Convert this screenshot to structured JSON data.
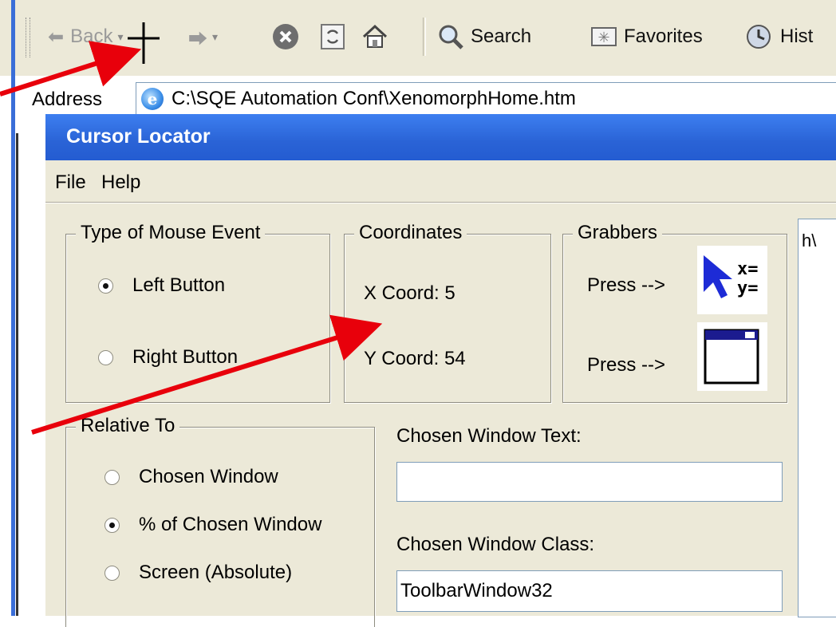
{
  "browser": {
    "toolbar": {
      "back_label": "Back",
      "search_label": "Search",
      "favorites_label": "Favorites",
      "history_label": "Hist"
    },
    "address": {
      "label": "Address",
      "value": "C:\\SQE Automation Conf\\XenomorphHome.htm"
    }
  },
  "dialog": {
    "title": "Cursor Locator",
    "menu": [
      "File",
      "Help"
    ],
    "mouse_event": {
      "legend": "Type of Mouse Event",
      "options": [
        {
          "label": "Left Button",
          "checked": true
        },
        {
          "label": "Right Button",
          "checked": false
        }
      ]
    },
    "coordinates": {
      "legend": "Coordinates",
      "x_label": "X Coord:",
      "x_value": "5",
      "y_label": "Y Coord:",
      "y_value": "54"
    },
    "grabbers": {
      "legend": "Grabbers",
      "press_label_1": "Press -->",
      "press_label_2": "Press -->",
      "icon_xy_text": "x=\ny="
    },
    "relative_to": {
      "legend": "Relative To",
      "options": [
        {
          "label": "Chosen Window",
          "checked": false
        },
        {
          "label": "% of Chosen Window",
          "checked": true
        },
        {
          "label": "Screen (Absolute)",
          "checked": false
        }
      ]
    },
    "chosen_window_text": {
      "label": "Chosen Window Text:",
      "value": ""
    },
    "chosen_window_class": {
      "label": "Chosen Window Class:",
      "value": "ToolbarWindow32"
    },
    "side_list_text": "h\\"
  },
  "colors": {
    "title_blue": "#2a63d6",
    "dialog_bg": "#ece9d8",
    "annotation_red": "#e8000b"
  },
  "annotations": {
    "arrows": 3,
    "crosshair": "crosshair-cursor"
  }
}
